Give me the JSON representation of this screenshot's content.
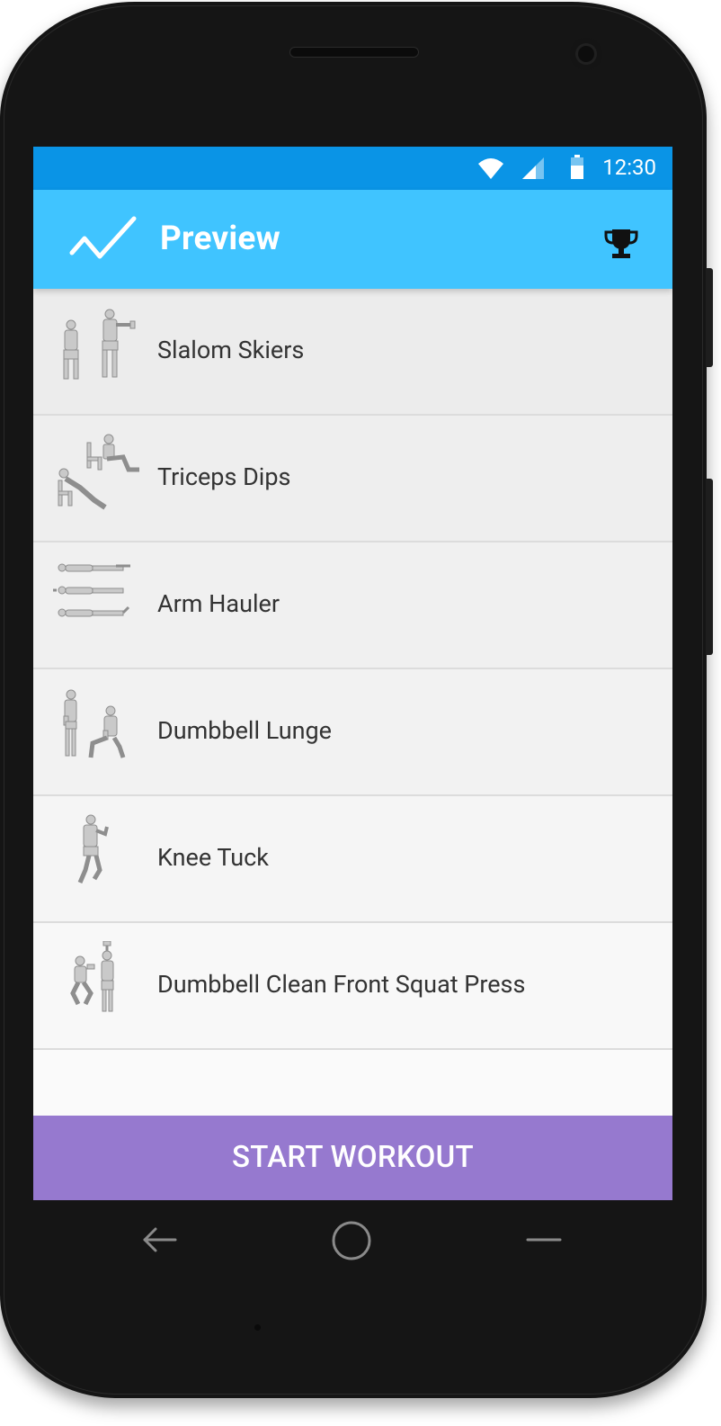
{
  "status_bar": {
    "time": "12:30",
    "icons": [
      "wifi-icon",
      "cell-signal-icon",
      "battery-icon"
    ]
  },
  "app_bar": {
    "title": "Preview",
    "logo_icon": "checkmark-trend-icon",
    "action_icon": "trophy-icon"
  },
  "exercises": [
    {
      "name": "Slalom Skiers",
      "illustration": "slalom-skiers-illustration"
    },
    {
      "name": "Triceps Dips",
      "illustration": "triceps-dips-illustration"
    },
    {
      "name": "Arm Hauler",
      "illustration": "arm-hauler-illustration"
    },
    {
      "name": "Dumbbell Lunge",
      "illustration": "dumbbell-lunge-illustration"
    },
    {
      "name": "Knee Tuck",
      "illustration": "knee-tuck-illustration"
    },
    {
      "name": "Dumbbell Clean Front Squat Press",
      "illustration": "dumbbell-clean-front-squat-press-illustration"
    }
  ],
  "start_button": {
    "label": "START WORKOUT"
  },
  "nav_bar": {
    "icons": [
      "back-icon",
      "home-icon",
      "recents-icon"
    ]
  },
  "colors": {
    "status_bar": "#0a94e6",
    "app_bar": "#40c4ff",
    "start_button": "#9679cf",
    "list_background": "#fafafa"
  }
}
